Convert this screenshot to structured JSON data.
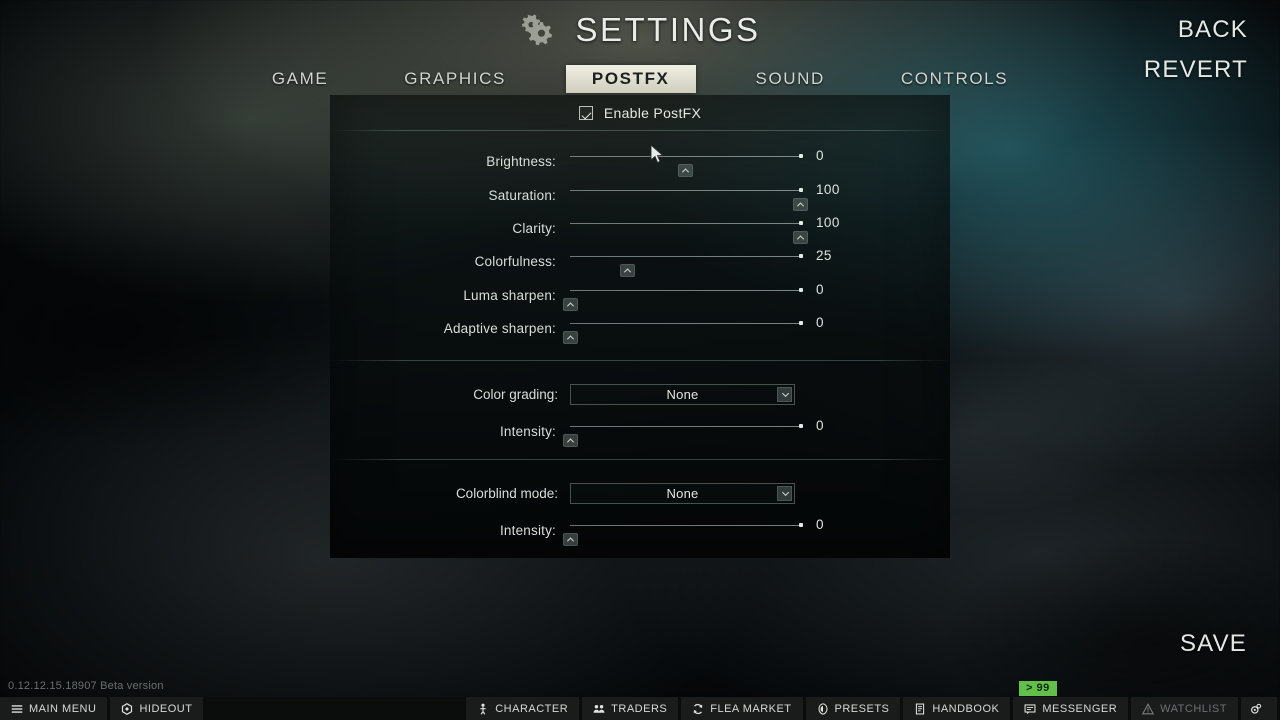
{
  "header": {
    "title": "SETTINGS",
    "gear_icon": "gears-icon",
    "tabs": [
      {
        "label": "GAME",
        "active": false
      },
      {
        "label": "GRAPHICS",
        "active": false
      },
      {
        "label": "POSTFX",
        "active": true
      },
      {
        "label": "SOUND",
        "active": false
      },
      {
        "label": "CONTROLS",
        "active": false
      }
    ],
    "back_label": "BACK",
    "revert_label": "REVERT"
  },
  "footer": {
    "save_label": "SAVE",
    "version": "0.12.12.15.18907 Beta version"
  },
  "panel": {
    "enable_label": "Enable PostFX",
    "enable_checked": true,
    "sliders_primary": [
      {
        "label": "Brightness:",
        "value": "0",
        "percent": 50
      },
      {
        "label": "Saturation:",
        "value": "100",
        "percent": 100
      },
      {
        "label": "Clarity:",
        "value": "100",
        "percent": 100
      },
      {
        "label": "Colorfulness:",
        "value": "25",
        "percent": 25
      },
      {
        "label": "Luma sharpen:",
        "value": "0",
        "percent": 0
      },
      {
        "label": "Adaptive sharpen:",
        "value": "0",
        "percent": 0
      }
    ],
    "color_grading": {
      "label": "Color grading:",
      "value": "None",
      "intensity_label": "Intensity:",
      "intensity_value": "0",
      "intensity_percent": 0
    },
    "colorblind": {
      "label": "Colorblind mode:",
      "value": "None",
      "intensity_label": "Intensity:",
      "intensity_value": "0",
      "intensity_percent": 0
    }
  },
  "taskbar": {
    "items": [
      {
        "label": "MAIN MENU",
        "icon": "hamburger-icon",
        "dim": false
      },
      {
        "label": "HIDEOUT",
        "icon": "hexagon-icon",
        "dim": false
      }
    ],
    "right_items": [
      {
        "label": "CHARACTER",
        "icon": "person-icon",
        "dim": false
      },
      {
        "label": "TRADERS",
        "icon": "people-icon",
        "dim": false
      },
      {
        "label": "FLEA MARKET",
        "icon": "refresh-icon",
        "dim": false
      },
      {
        "label": "PRESETS",
        "icon": "shield-icon",
        "dim": false
      },
      {
        "label": "HANDBOOK",
        "icon": "book-icon",
        "dim": false
      },
      {
        "label": "MESSENGER",
        "icon": "chat-icon",
        "dim": false
      },
      {
        "label": "WATCHLIST",
        "icon": "warning-icon",
        "dim": true
      },
      {
        "label": "",
        "icon": "settings-gear-icon",
        "dim": false
      }
    ],
    "badge": "> 99",
    "badge_color": "#62c04a"
  }
}
